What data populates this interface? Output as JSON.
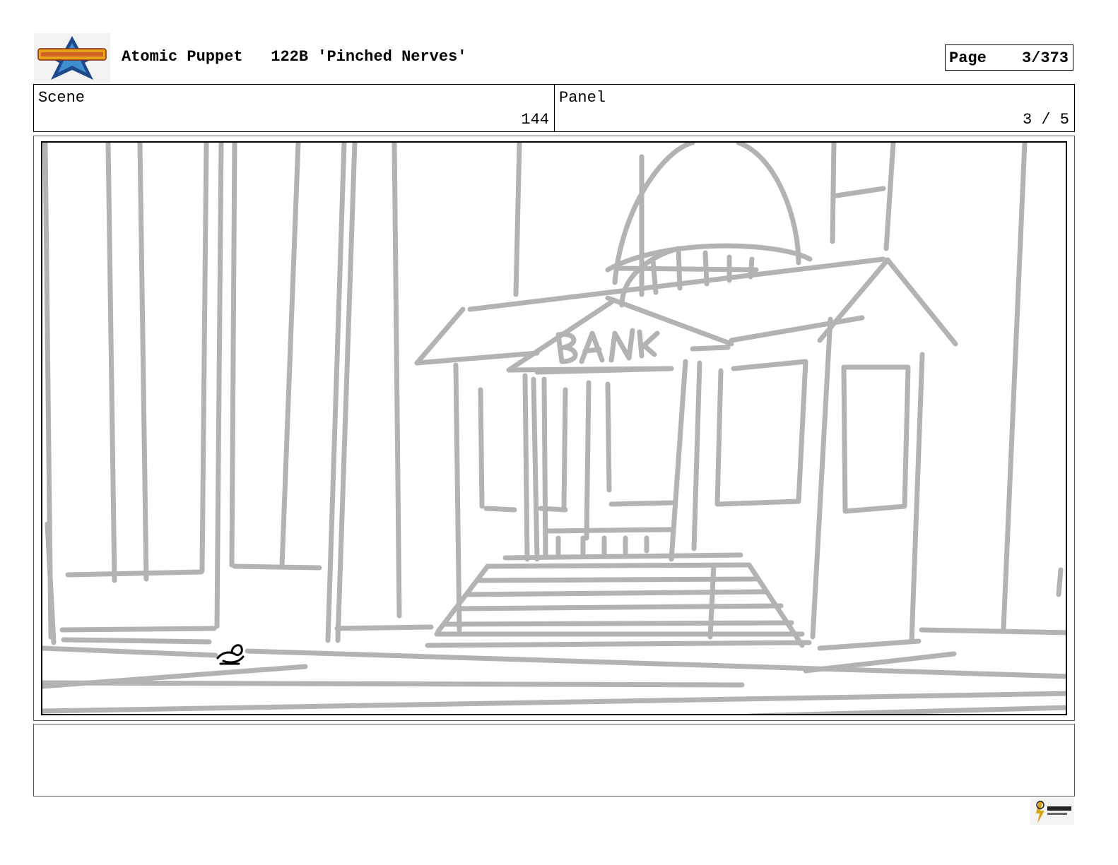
{
  "header": {
    "show": "Atomic Puppet",
    "episode": "122B 'Pinched Nerves'",
    "page_label": "Page",
    "page_value": "3/373"
  },
  "info": {
    "scene_label": "Scene",
    "scene_value": "144",
    "panel_label": "Panel",
    "panel_value": "3 / 5"
  },
  "artwork": {
    "sign_text": "BANK"
  },
  "notes": {
    "text": ""
  }
}
